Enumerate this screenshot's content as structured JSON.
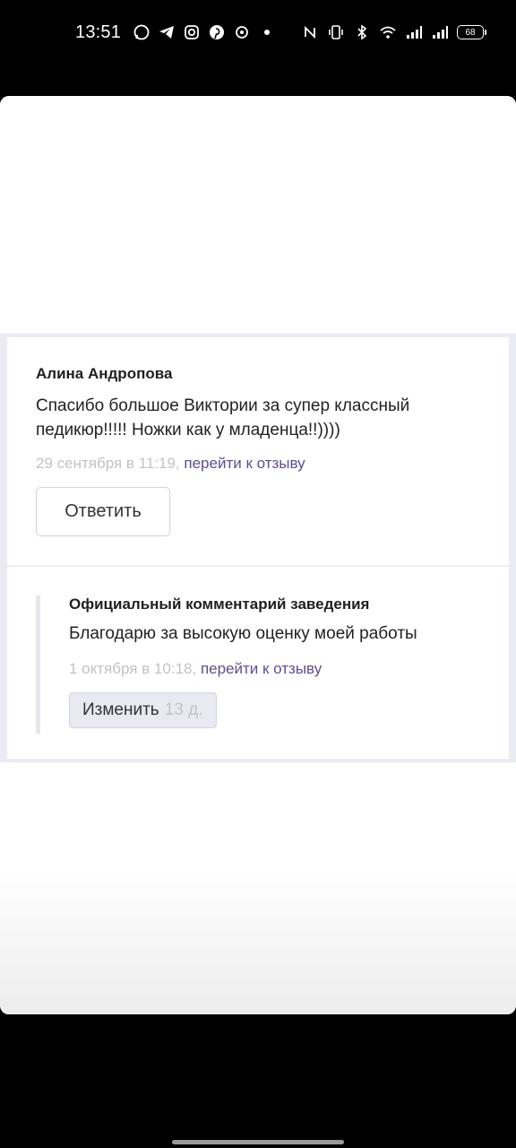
{
  "status_bar": {
    "time": "13:51",
    "battery": "68",
    "left_icons": [
      "whatsapp-icon",
      "telegram-icon",
      "instagram-icon",
      "pinterest-icon",
      "app-icon",
      "dot-icon"
    ],
    "right_icons": [
      "nfc-icon",
      "vibrate-icon",
      "bluetooth-icon",
      "wifi-icon",
      "signal-icon",
      "signal-icon"
    ]
  },
  "review": {
    "author": "Алина Андропова",
    "text": "Спасибо большое Виктории за супер классный педикюр!!!!! Ножки как у младенца!!))))",
    "date": "29 сентября в 11:19,",
    "link": "перейти к отзыву",
    "reply_label": "Ответить"
  },
  "official": {
    "title": "Официальный комментарий заведения",
    "text": "Благодарю за высокую оценку моей работы",
    "date": "1 октября в 10:18,",
    "link": "перейти к отзыву",
    "edit_label": "Изменить",
    "edit_days": "13 д."
  },
  "colors": {
    "link": "#5f4b95",
    "muted": "#c2c2c8",
    "band": "#ebebf3"
  }
}
